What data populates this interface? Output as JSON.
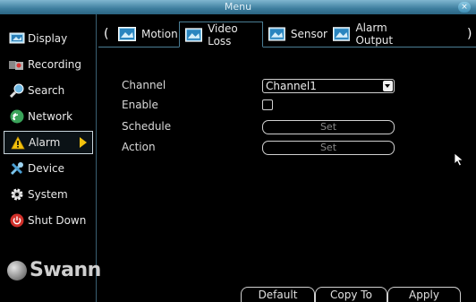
{
  "window": {
    "title": "Menu",
    "close_label": "×"
  },
  "sidebar": {
    "items": [
      {
        "label": "Display",
        "icon": "display-icon"
      },
      {
        "label": "Recording",
        "icon": "recording-icon"
      },
      {
        "label": "Search",
        "icon": "search-icon"
      },
      {
        "label": "Network",
        "icon": "network-icon"
      },
      {
        "label": "Alarm",
        "icon": "alarm-icon",
        "active": true
      },
      {
        "label": "Device",
        "icon": "device-icon"
      },
      {
        "label": "System",
        "icon": "gear-icon"
      },
      {
        "label": "Shut Down",
        "icon": "power-icon"
      }
    ],
    "logo_text": "Swann"
  },
  "tabs": {
    "prev_label": "(",
    "next_label": ")",
    "items": [
      {
        "label": "Motion"
      },
      {
        "label": "Video Loss",
        "active": true
      },
      {
        "label": "Sensor"
      },
      {
        "label": "Alarm Output"
      }
    ]
  },
  "form": {
    "channel_label": "Channel",
    "channel_value": "Channel1",
    "enable_label": "Enable",
    "enable_checked": false,
    "schedule_label": "Schedule",
    "schedule_button": "Set",
    "action_label": "Action",
    "action_button": "Set"
  },
  "footer": {
    "default_label": "Default",
    "copy_to_label": "Copy To",
    "apply_label": "Apply"
  },
  "colors": {
    "accent": "#3d7e9e",
    "active_arrow": "#f4c20d",
    "border": "#4a7d94"
  }
}
